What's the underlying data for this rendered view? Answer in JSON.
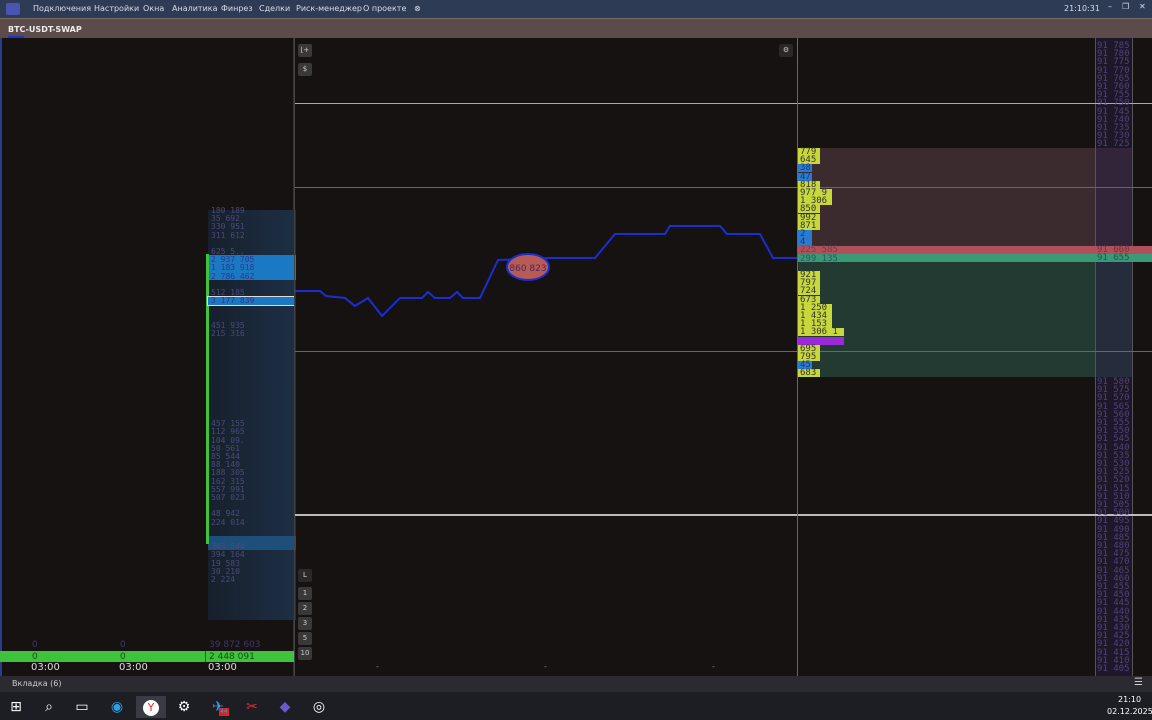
{
  "titlebar": {
    "menu": [
      "Подключения",
      "Настройки",
      "Окна",
      "Аналитика",
      "Финрез",
      "Сделки",
      "Риск-менеджер",
      "О проекте"
    ],
    "clock": "21:10:31",
    "minimize": "–",
    "maximize": "❐",
    "close": "✕",
    "pin_icon": "pin-off-icon"
  },
  "symbol": "BTC-USDT-SWAP",
  "left_ladder": [
    "180 189",
    "35 692",
    "330 951",
    "311 612",
    "",
    "625 5..",
    "2 937 705",
    "1 183 918",
    "2 786 462",
    "",
    "512 185",
    "3 177 839",
    "",
    "",
    "451 935",
    "215 316",
    "",
    "",
    "",
    "",
    "",
    "",
    "",
    "",
    "",
    "",
    "457 155",
    "112 965",
    "104 09.",
    "50 561",
    "85 544",
    "88 140",
    "188 305",
    "162 315",
    "557 991",
    "507 023",
    "",
    "48 942",
    "224 014",
    "",
    "",
    "343 544",
    "394 164",
    "19 583",
    "30 210",
    "2 224"
  ],
  "left_footer": {
    "row1": [
      "0",
      "0",
      "39 872 603"
    ],
    "row2": [
      "0",
      "0",
      "2 448 091"
    ],
    "times": [
      "03:00",
      "03:00",
      "03:00"
    ]
  },
  "chart": {
    "bubble": "860 823",
    "tools": {
      "indicator_icon": "chart-indicator-icon",
      "currency": "$",
      "settings_icon": "gear-icon"
    },
    "scale_buttons": [
      "L",
      "1",
      "2",
      "3",
      "5",
      "10"
    ],
    "x_ticks": [
      "-",
      "-",
      "-"
    ],
    "line_color": "#1a2fd0"
  },
  "volume_rows": [
    {
      "v": "779",
      "c": "y"
    },
    {
      "v": "645",
      "c": "y"
    },
    {
      "v": "38",
      "c": "b"
    },
    {
      "v": "47",
      "c": "b"
    },
    {
      "v": "818",
      "c": "y"
    },
    {
      "v": "977 9",
      "c": "y"
    },
    {
      "v": "1 306",
      "c": "y"
    },
    {
      "v": "850",
      "c": "y"
    },
    {
      "v": "992",
      "c": "y"
    },
    {
      "v": "871",
      "c": "y"
    },
    {
      "v": "2",
      "c": "b"
    },
    {
      "v": "4",
      "c": "b"
    },
    {
      "v": "225 585",
      "c": "ask"
    },
    {
      "v": "299 135",
      "c": "bid"
    },
    {
      "v": "",
      "c": ""
    },
    {
      "v": "921",
      "c": "y"
    },
    {
      "v": "797",
      "c": "y"
    },
    {
      "v": "724",
      "c": "y"
    },
    {
      "v": "673",
      "c": "y"
    },
    {
      "v": "1 250",
      "c": "y"
    },
    {
      "v": "1 434",
      "c": "y"
    },
    {
      "v": "1 153",
      "c": "y"
    },
    {
      "v": "1 306 1",
      "c": "y"
    },
    {
      "v": "",
      "c": "p"
    },
    {
      "v": "695",
      "c": "y"
    },
    {
      "v": "795",
      "c": "y"
    },
    {
      "v": "45",
      "c": "b"
    },
    {
      "v": "683",
      "c": "y"
    }
  ],
  "prices_top": [
    "91 785",
    "91 780",
    "91 775",
    "91 770",
    "91 765",
    "91 760",
    "91 755",
    "91 750",
    "91 745",
    "91 740",
    "91 735",
    "91 730",
    "91 725"
  ],
  "price_ask": "91 660",
  "price_bid": "91 655",
  "prices_bottom": [
    "91 580",
    "91 575",
    "91 570",
    "91 565",
    "91 560",
    "91 555",
    "91 550",
    "91 545",
    "91 540",
    "91 535",
    "91 530",
    "91 525",
    "91 520",
    "91 515",
    "91 510",
    "91 505",
    "91 500",
    "91 495",
    "91 490",
    "91 485",
    "91 480",
    "91 475",
    "91 470",
    "91 465",
    "91 460",
    "91 455",
    "91 450",
    "91 445",
    "91 440",
    "91 435",
    "91 430",
    "91 425",
    "91 420",
    "91 415",
    "91 410",
    "91 405"
  ],
  "colors": {
    "ask": "#b0505a",
    "bid": "#3a9a78",
    "volume": "#c8d83a",
    "accent_green": "#3ec43a"
  },
  "tabbar": {
    "tab": "Вкладка (6)"
  },
  "taskbar": {
    "time": "21:10",
    "date": "02.12.2025",
    "telegram_badge": "44"
  }
}
